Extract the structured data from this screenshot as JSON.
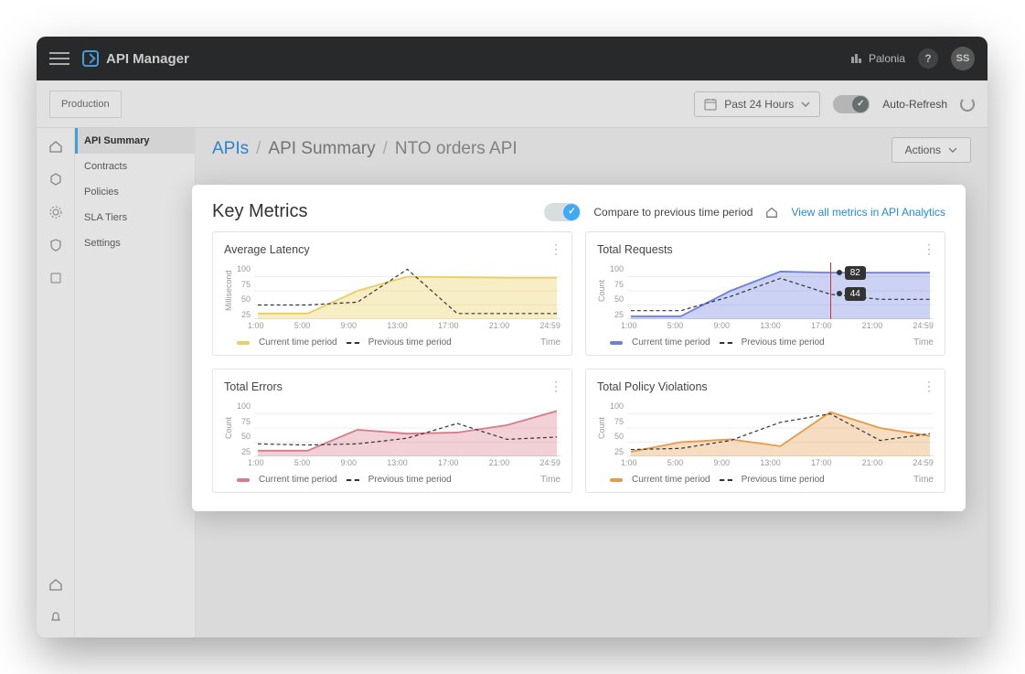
{
  "app_title": "API Manager",
  "org_name": "Palonia",
  "help_label": "?",
  "user_initials": "SS",
  "environment": "Production",
  "time_range": "Past 24 Hours",
  "auto_refresh_label": "Auto-Refresh",
  "nav": {
    "items": [
      "API Summary",
      "Contracts",
      "Policies",
      "SLA Tiers",
      "Settings"
    ],
    "active_index": 0
  },
  "breadcrumb": {
    "root": "APIs",
    "mid": "API Summary",
    "leaf": "NTO orders API"
  },
  "actions_label": "Actions",
  "panel": {
    "title": "Key Metrics",
    "compare_label": "Compare to previous time period",
    "link_label": "View all metrics in API Analytics"
  },
  "legend": {
    "current": "Current time period",
    "previous": "Previous time period",
    "xlabel": "Time"
  },
  "x_ticks": [
    "1:00",
    "5:00",
    "9:00",
    "13:00",
    "17:00",
    "21:00",
    "24:59"
  ],
  "y_ticks": [
    "100",
    "75",
    "50",
    "25"
  ],
  "colors": {
    "latency": "#e9cf5d",
    "requests": "#6a7fe0",
    "errors": "#d97a8a",
    "violations": "#e69a4a"
  },
  "tooltip": {
    "top_value": "82",
    "bottom_value": "44"
  },
  "chart_data": [
    {
      "id": "latency",
      "title": "Average Latency",
      "ylabel": "Millisecond",
      "type": "area",
      "categories": [
        "1:00",
        "5:00",
        "9:00",
        "13:00",
        "17:00",
        "21:00",
        "24:59"
      ],
      "series": [
        {
          "name": "Current time period",
          "values": [
            10,
            10,
            50,
            75,
            74,
            73,
            73
          ]
        },
        {
          "name": "Previous time period",
          "values": [
            25,
            25,
            30,
            88,
            10,
            10,
            10
          ]
        }
      ],
      "ylim": [
        0,
        100
      ]
    },
    {
      "id": "requests",
      "title": "Total Requests",
      "ylabel": "Count",
      "type": "area",
      "categories": [
        "1:00",
        "5:00",
        "9:00",
        "13:00",
        "17:00",
        "21:00",
        "24:59"
      ],
      "series": [
        {
          "name": "Current time period",
          "values": [
            5,
            5,
            50,
            84,
            82,
            82,
            82
          ]
        },
        {
          "name": "Previous time period",
          "values": [
            15,
            15,
            40,
            72,
            44,
            35,
            35
          ]
        }
      ],
      "ylim": [
        0,
        100
      ],
      "hover_x": "17:00",
      "hover_values": [
        82,
        44
      ]
    },
    {
      "id": "errors",
      "title": "Total Errors",
      "ylabel": "Count",
      "type": "area",
      "categories": [
        "1:00",
        "5:00",
        "9:00",
        "13:00",
        "17:00",
        "21:00",
        "24:59"
      ],
      "series": [
        {
          "name": "Current time period",
          "values": [
            10,
            10,
            47,
            40,
            42,
            55,
            80
          ]
        },
        {
          "name": "Previous time period",
          "values": [
            22,
            20,
            22,
            32,
            58,
            30,
            34
          ]
        }
      ],
      "ylim": [
        0,
        100
      ]
    },
    {
      "id": "violations",
      "title": "Total Policy Violations",
      "ylabel": "Count",
      "type": "area",
      "categories": [
        "1:00",
        "5:00",
        "9:00",
        "13:00",
        "17:00",
        "21:00",
        "24:59"
      ],
      "series": [
        {
          "name": "Current time period",
          "values": [
            8,
            25,
            30,
            18,
            78,
            50,
            36
          ]
        },
        {
          "name": "Previous time period",
          "values": [
            12,
            14,
            28,
            60,
            75,
            28,
            40
          ]
        }
      ],
      "ylim": [
        0,
        100
      ]
    }
  ]
}
